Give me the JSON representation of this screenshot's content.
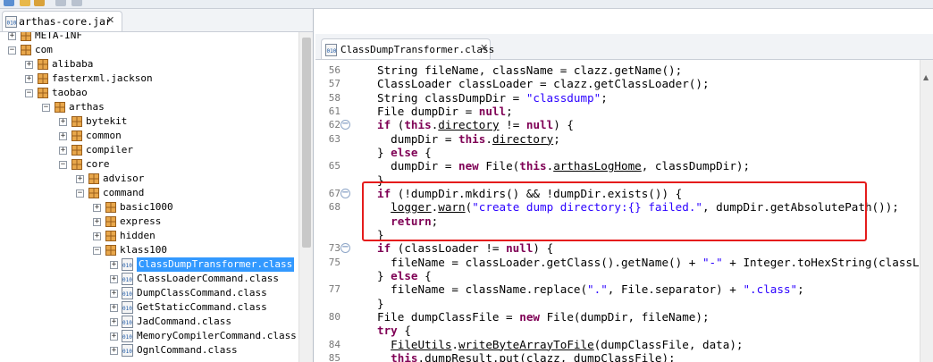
{
  "left_tab": {
    "title": "arthas-core.jar"
  },
  "tree": [
    {
      "label": "META-INF",
      "depth": 1,
      "kind": "folder",
      "state": "plus"
    },
    {
      "label": "com",
      "depth": 1,
      "kind": "pkg",
      "state": "minus"
    },
    {
      "label": "alibaba",
      "depth": 2,
      "kind": "pkg",
      "state": "plus"
    },
    {
      "label": "fasterxml.jackson",
      "depth": 2,
      "kind": "pkg",
      "state": "plus"
    },
    {
      "label": "taobao",
      "depth": 2,
      "kind": "pkg",
      "state": "minus"
    },
    {
      "label": "arthas",
      "depth": 3,
      "kind": "pkg",
      "state": "minus"
    },
    {
      "label": "bytekit",
      "depth": 4,
      "kind": "pkg",
      "state": "plus"
    },
    {
      "label": "common",
      "depth": 4,
      "kind": "pkg",
      "state": "plus"
    },
    {
      "label": "compiler",
      "depth": 4,
      "kind": "pkg",
      "state": "plus"
    },
    {
      "label": "core",
      "depth": 4,
      "kind": "pkg",
      "state": "minus"
    },
    {
      "label": "advisor",
      "depth": 5,
      "kind": "pkg",
      "state": "plus"
    },
    {
      "label": "command",
      "depth": 5,
      "kind": "pkg",
      "state": "minus"
    },
    {
      "label": "basic1000",
      "depth": 6,
      "kind": "pkg",
      "state": "plus"
    },
    {
      "label": "express",
      "depth": 6,
      "kind": "pkg",
      "state": "plus"
    },
    {
      "label": "hidden",
      "depth": 6,
      "kind": "pkg",
      "state": "plus"
    },
    {
      "label": "klass100",
      "depth": 6,
      "kind": "pkg",
      "state": "minus"
    },
    {
      "label": "ClassDumpTransformer.class",
      "depth": 7,
      "kind": "class",
      "state": "plus",
      "selected": true
    },
    {
      "label": "ClassLoaderCommand.class",
      "depth": 7,
      "kind": "class",
      "state": "plus"
    },
    {
      "label": "DumpClassCommand.class",
      "depth": 7,
      "kind": "class",
      "state": "plus"
    },
    {
      "label": "GetStaticCommand.class",
      "depth": 7,
      "kind": "class",
      "state": "plus"
    },
    {
      "label": "JadCommand.class",
      "depth": 7,
      "kind": "class",
      "state": "plus"
    },
    {
      "label": "MemoryCompilerCommand.class",
      "depth": 7,
      "kind": "class",
      "state": "plus"
    },
    {
      "label": "OgnlCommand.class",
      "depth": 7,
      "kind": "class",
      "state": "plus"
    }
  ],
  "editor_tab": {
    "title": "ClassDumpTransformer.class"
  },
  "code_lines": [
    {
      "ln": "56",
      "fold": "",
      "segs": [
        {
          "t": "String fileName, className = clazz.getName();"
        }
      ]
    },
    {
      "ln": "57",
      "fold": "",
      "segs": [
        {
          "t": "ClassLoader classLoader = clazz.getClassLoader();"
        }
      ]
    },
    {
      "ln": "58",
      "fold": "",
      "segs": [
        {
          "t": "String classDumpDir = "
        },
        {
          "t": "\"classdump\"",
          "c": "st"
        },
        {
          "t": ";"
        }
      ]
    },
    {
      "ln": "61",
      "fold": "",
      "segs": [
        {
          "t": "File dumpDir = "
        },
        {
          "t": "null",
          "c": "kw"
        },
        {
          "t": ";"
        }
      ]
    },
    {
      "ln": "62",
      "fold": "minus",
      "segs": [
        {
          "t": "if",
          "c": "kw"
        },
        {
          "t": " ("
        },
        {
          "t": "this",
          "c": "kw"
        },
        {
          "t": "."
        },
        {
          "t": "directory",
          "c": "ul"
        },
        {
          "t": " != "
        },
        {
          "t": "null",
          "c": "kw"
        },
        {
          "t": ") {"
        }
      ]
    },
    {
      "ln": "63",
      "fold": "",
      "segs": [
        {
          "t": "  dumpDir = "
        },
        {
          "t": "this",
          "c": "kw"
        },
        {
          "t": "."
        },
        {
          "t": "directory",
          "c": "ul"
        },
        {
          "t": ";"
        }
      ]
    },
    {
      "ln": "",
      "fold": "",
      "segs": [
        {
          "t": "} "
        },
        {
          "t": "else",
          "c": "kw"
        },
        {
          "t": " {"
        }
      ]
    },
    {
      "ln": "65",
      "fold": "",
      "segs": [
        {
          "t": "  dumpDir = "
        },
        {
          "t": "new",
          "c": "kw"
        },
        {
          "t": " File("
        },
        {
          "t": "this",
          "c": "kw"
        },
        {
          "t": "."
        },
        {
          "t": "arthasLogHome",
          "c": "ul"
        },
        {
          "t": ", classDumpDir);"
        }
      ]
    },
    {
      "ln": "",
      "fold": "",
      "segs": [
        {
          "t": "}"
        }
      ]
    },
    {
      "ln": "67",
      "fold": "minus",
      "segs": [
        {
          "t": "if",
          "c": "kw"
        },
        {
          "t": " (!dumpDir.mkdirs() && !dumpDir.exists()) {"
        }
      ]
    },
    {
      "ln": "68",
      "fold": "",
      "segs": [
        {
          "t": "  "
        },
        {
          "t": "logger",
          "c": "ul"
        },
        {
          "t": "."
        },
        {
          "t": "warn",
          "c": "ul"
        },
        {
          "t": "("
        },
        {
          "t": "\"create dump directory:{} failed.\"",
          "c": "st"
        },
        {
          "t": ", dumpDir.getAbsolutePath());"
        }
      ]
    },
    {
      "ln": "",
      "fold": "",
      "segs": [
        {
          "t": "  "
        },
        {
          "t": "return",
          "c": "kw"
        },
        {
          "t": ";"
        }
      ]
    },
    {
      "ln": "",
      "fold": "",
      "segs": [
        {
          "t": "}"
        }
      ]
    },
    {
      "ln": "73",
      "fold": "minus",
      "segs": [
        {
          "t": "if",
          "c": "kw"
        },
        {
          "t": " (classLoader != "
        },
        {
          "t": "null",
          "c": "kw"
        },
        {
          "t": ") {"
        }
      ]
    },
    {
      "ln": "75",
      "fold": "",
      "segs": [
        {
          "t": "  fileName = classLoader.getClass().getName() + "
        },
        {
          "t": "\"-\"",
          "c": "st"
        },
        {
          "t": " + Integer.toHexString(classLoader.h"
        }
      ]
    },
    {
      "ln": "",
      "fold": "",
      "segs": [
        {
          "t": "} "
        },
        {
          "t": "else",
          "c": "kw"
        },
        {
          "t": " {"
        }
      ]
    },
    {
      "ln": "77",
      "fold": "",
      "segs": [
        {
          "t": "  fileName = className.replace("
        },
        {
          "t": "\".\"",
          "c": "st"
        },
        {
          "t": ", File.separator) + "
        },
        {
          "t": "\".class\"",
          "c": "st"
        },
        {
          "t": ";"
        }
      ]
    },
    {
      "ln": "",
      "fold": "",
      "segs": [
        {
          "t": "}"
        }
      ]
    },
    {
      "ln": "80",
      "fold": "",
      "segs": [
        {
          "t": "File dumpClassFile = "
        },
        {
          "t": "new",
          "c": "kw"
        },
        {
          "t": " File(dumpDir, fileName);"
        }
      ]
    },
    {
      "ln": "",
      "fold": "",
      "segs": [
        {
          "t": "try",
          "c": "kw"
        },
        {
          "t": " {"
        }
      ]
    },
    {
      "ln": "84",
      "fold": "",
      "segs": [
        {
          "t": "  "
        },
        {
          "t": "FileUtils",
          "c": "ul"
        },
        {
          "t": "."
        },
        {
          "t": "writeByteArrayToFile",
          "c": "ul"
        },
        {
          "t": "(dumpClassFile, data);"
        }
      ]
    },
    {
      "ln": "85",
      "fold": "",
      "segs": [
        {
          "t": "  "
        },
        {
          "t": "this",
          "c": "kw"
        },
        {
          "t": ".dumpResult.put(clazz, dumpClassFile);"
        }
      ]
    }
  ]
}
